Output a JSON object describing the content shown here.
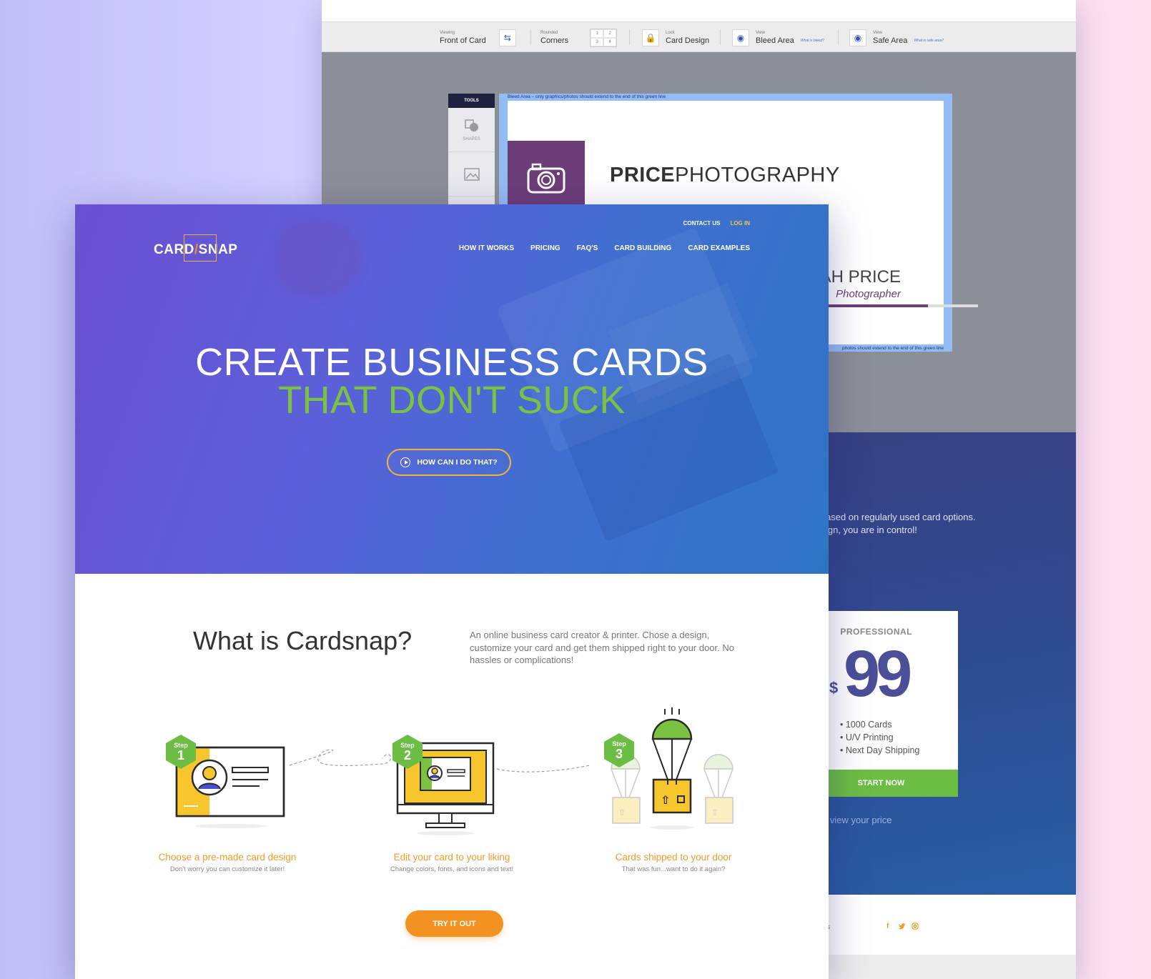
{
  "editor": {
    "toolbar": {
      "viewing": {
        "small": "Viewing",
        "main": "Front of Card"
      },
      "corners": {
        "small": "Rounded",
        "main": "Corners",
        "grid": [
          "1",
          "2",
          "3",
          "4"
        ]
      },
      "lock": {
        "small": "Lock",
        "main": "Card Design"
      },
      "bleed": {
        "small": "View",
        "main": "Bleed Area",
        "help": "What is bleed?"
      },
      "safe": {
        "small": "View",
        "main": "Safe Area",
        "help": "What is safe area?"
      }
    },
    "tools": {
      "title": "TOOLS",
      "shapes_label": "SHAPES"
    },
    "bleed_note_top": "Bleed Area – only graphics/photos should extend to the end of this green line",
    "bleed_note_bottom": "photos should extend to the end of this green line",
    "card": {
      "brand_bold": "PRICE",
      "brand_light": "PHOTOGRAPHY",
      "name": "AH PRICE",
      "role": "Photographer"
    },
    "pricing": {
      "text_line1": "ased on regularly used card options.",
      "text_line2": "ign, you are in control!",
      "tier": "PROFESSIONAL",
      "currency": "$",
      "amount": "99",
      "features": [
        "• 1000 Cards",
        "• U/V Printing",
        "• Next Day Shipping"
      ],
      "cta": "START NOW",
      "view_price": "o view your price"
    },
    "footer": {
      "us": "Us",
      "social": [
        "f",
        "t",
        "ig"
      ]
    }
  },
  "site": {
    "logo": {
      "left": "CARD",
      "slash": "/",
      "right": "SNAP"
    },
    "top_links": {
      "contact": "CONTACT US",
      "login": "LOG IN"
    },
    "nav": [
      "HOW IT WORKS",
      "PRICING",
      "FAQ'S",
      "CARD BUILDING",
      "CARD EXAMPLES"
    ],
    "hero": {
      "line1": "CREATE BUSINESS CARDS",
      "line2": "THAT DON'T SUCK",
      "button": "HOW CAN I DO THAT?"
    },
    "what": {
      "title": "What is Cardsnap?",
      "description": "An online business card creator & printer. Chose a design, customize your card and get them shipped right to your door. No hassles or complications!"
    },
    "steps": [
      {
        "step": "Step",
        "num": "1",
        "title": "Choose a pre-made card design",
        "sub": "Don't worry you can customize it later!"
      },
      {
        "step": "Step",
        "num": "2",
        "title": "Edit your card to your liking",
        "sub": "Change colors, fonts, and icons and text!"
      },
      {
        "step": "Step",
        "num": "3",
        "title": "Cards shipped to your door",
        "sub": "That was fun...want to do it again?"
      }
    ],
    "cta": "TRY IT OUT"
  },
  "colors": {
    "accent_green": "#7cc242",
    "accent_orange": "#f39221",
    "brand_purple": "#6d3d78",
    "hero_start": "#6a4fd2",
    "hero_end": "#2f74c4"
  }
}
